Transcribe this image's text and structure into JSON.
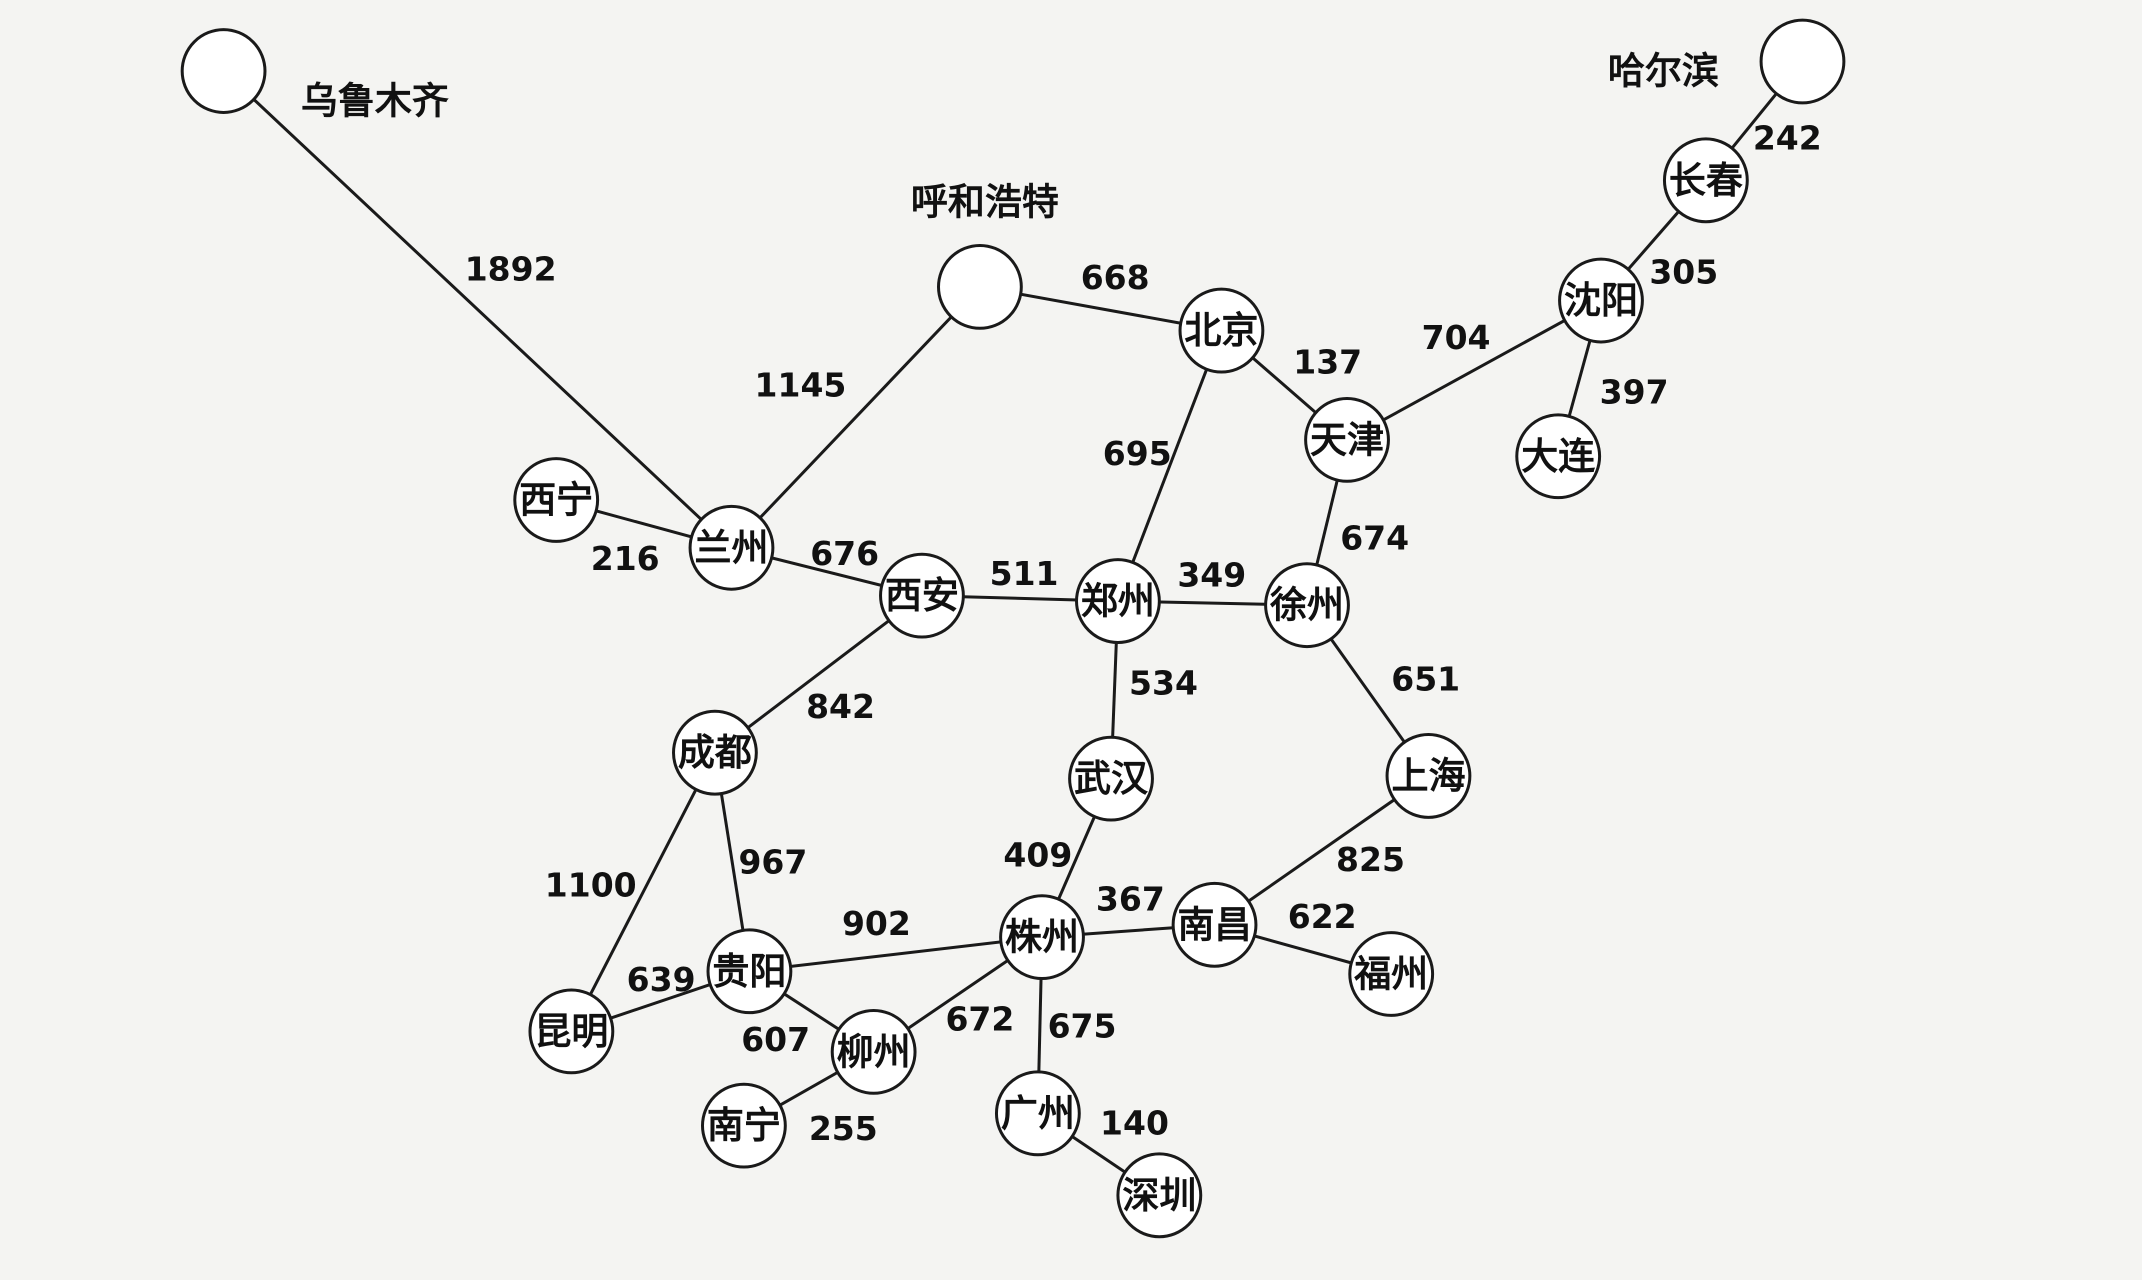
{
  "diagram": {
    "background_color": "#f4f4f2",
    "line_color": "#1a1a1a",
    "nodes": [
      {
        "id": "wulumuqi",
        "label": "乌鲁木齐"
      },
      {
        "id": "huhehaote",
        "label": "呼和浩特"
      },
      {
        "id": "haerbin",
        "label": "哈尔滨"
      },
      {
        "id": "changchun",
        "label": "长春"
      },
      {
        "id": "shenyang",
        "label": "沈阳"
      },
      {
        "id": "dalian",
        "label": "大连"
      },
      {
        "id": "beijing",
        "label": "北京"
      },
      {
        "id": "tianjin",
        "label": "天津"
      },
      {
        "id": "xining",
        "label": "西宁"
      },
      {
        "id": "lanzhou",
        "label": "兰州"
      },
      {
        "id": "xian",
        "label": "西安"
      },
      {
        "id": "zhengzhou",
        "label": "郑州"
      },
      {
        "id": "xuzhou",
        "label": "徐州"
      },
      {
        "id": "chengdu",
        "label": "成都"
      },
      {
        "id": "wuhan",
        "label": "武汉"
      },
      {
        "id": "shanghai",
        "label": "上海"
      },
      {
        "id": "guiyang",
        "label": "贵阳"
      },
      {
        "id": "kunming",
        "label": "昆明"
      },
      {
        "id": "zhuzhou",
        "label": "株州"
      },
      {
        "id": "nanchang",
        "label": "南昌"
      },
      {
        "id": "fuzhou",
        "label": "福州"
      },
      {
        "id": "liuzhou",
        "label": "柳州"
      },
      {
        "id": "nanning",
        "label": "南宁"
      },
      {
        "id": "guangzhou",
        "label": "广州"
      },
      {
        "id": "shenzhen",
        "label": "深圳"
      }
    ],
    "edges": [
      {
        "from": "wulumuqi",
        "to": "lanzhou",
        "weight": "1892"
      },
      {
        "from": "huhehaote",
        "to": "lanzhou",
        "weight": "1145"
      },
      {
        "from": "huhehaote",
        "to": "beijing",
        "weight": "668"
      },
      {
        "from": "haerbin",
        "to": "changchun",
        "weight": "242"
      },
      {
        "from": "changchun",
        "to": "shenyang",
        "weight": "305"
      },
      {
        "from": "shenyang",
        "to": "dalian",
        "weight": "397"
      },
      {
        "from": "shenyang",
        "to": "tianjin",
        "weight": "704"
      },
      {
        "from": "beijing",
        "to": "tianjin",
        "weight": "137"
      },
      {
        "from": "beijing",
        "to": "zhengzhou",
        "weight": "695"
      },
      {
        "from": "tianjin",
        "to": "xuzhou",
        "weight": "674"
      },
      {
        "from": "xining",
        "to": "lanzhou",
        "weight": "216"
      },
      {
        "from": "lanzhou",
        "to": "xian",
        "weight": "676"
      },
      {
        "from": "xian",
        "to": "zhengzhou",
        "weight": "511"
      },
      {
        "from": "zhengzhou",
        "to": "xuzhou",
        "weight": "349"
      },
      {
        "from": "xian",
        "to": "chengdu",
        "weight": "842"
      },
      {
        "from": "zhengzhou",
        "to": "wuhan",
        "weight": "534"
      },
      {
        "from": "xuzhou",
        "to": "shanghai",
        "weight": "651"
      },
      {
        "from": "chengdu",
        "to": "kunming",
        "weight": "1100"
      },
      {
        "from": "chengdu",
        "to": "guiyang",
        "weight": "967"
      },
      {
        "from": "wuhan",
        "to": "zhuzhou",
        "weight": "409"
      },
      {
        "from": "shanghai",
        "to": "nanchang",
        "weight": "825"
      },
      {
        "from": "guiyang",
        "to": "zhuzhou",
        "weight": "902"
      },
      {
        "from": "zhuzhou",
        "to": "nanchang",
        "weight": "367"
      },
      {
        "from": "nanchang",
        "to": "fuzhou",
        "weight": "622"
      },
      {
        "from": "guiyang",
        "to": "kunming",
        "weight": "639"
      },
      {
        "from": "guiyang",
        "to": "liuzhou",
        "weight": "607"
      },
      {
        "from": "zhuzhou",
        "to": "liuzhou",
        "weight": "672"
      },
      {
        "from": "zhuzhou",
        "to": "guangzhou",
        "weight": "675"
      },
      {
        "from": "liuzhou",
        "to": "nanning",
        "weight": "255"
      },
      {
        "from": "guangzhou",
        "to": "shenzhen",
        "weight": "140"
      }
    ]
  }
}
